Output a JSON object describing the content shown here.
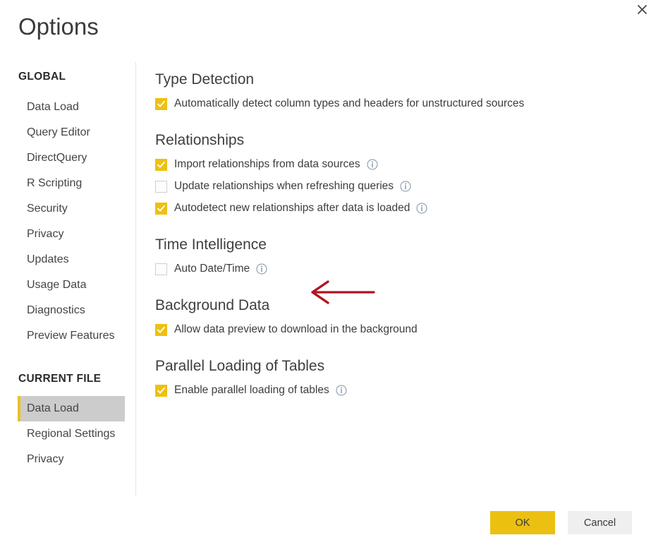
{
  "window": {
    "title": "Options",
    "close_icon": "close-icon"
  },
  "sidebar": {
    "groups": [
      {
        "title": "GLOBAL",
        "items": [
          {
            "label": "Data Load",
            "selected": false
          },
          {
            "label": "Query Editor",
            "selected": false
          },
          {
            "label": "DirectQuery",
            "selected": false
          },
          {
            "label": "R Scripting",
            "selected": false
          },
          {
            "label": "Security",
            "selected": false
          },
          {
            "label": "Privacy",
            "selected": false
          },
          {
            "label": "Updates",
            "selected": false
          },
          {
            "label": "Usage Data",
            "selected": false
          },
          {
            "label": "Diagnostics",
            "selected": false
          },
          {
            "label": "Preview Features",
            "selected": false
          }
        ]
      },
      {
        "title": "CURRENT FILE",
        "items": [
          {
            "label": "Data Load",
            "selected": true
          },
          {
            "label": "Regional Settings",
            "selected": false
          },
          {
            "label": "Privacy",
            "selected": false
          }
        ]
      }
    ]
  },
  "main": {
    "sections": [
      {
        "heading": "Type Detection",
        "options": [
          {
            "label": "Automatically detect column types and headers for unstructured sources",
            "checked": true,
            "info": false
          }
        ]
      },
      {
        "heading": "Relationships",
        "options": [
          {
            "label": "Import relationships from data sources",
            "checked": true,
            "info": true
          },
          {
            "label": "Update relationships when refreshing queries",
            "checked": false,
            "info": true
          },
          {
            "label": "Autodetect new relationships after data is loaded",
            "checked": true,
            "info": true
          }
        ]
      },
      {
        "heading": "Time Intelligence",
        "options": [
          {
            "label": "Auto Date/Time",
            "checked": false,
            "info": true
          }
        ]
      },
      {
        "heading": "Background Data",
        "options": [
          {
            "label": "Allow data preview to download in the background",
            "checked": true,
            "info": false
          }
        ]
      },
      {
        "heading": "Parallel Loading of Tables",
        "options": [
          {
            "label": "Enable parallel loading of tables",
            "checked": true,
            "info": true
          }
        ]
      }
    ]
  },
  "annotation": {
    "type": "arrow",
    "direction": "left",
    "points_at": "Auto Date/Time",
    "color": "#b01520"
  },
  "footer": {
    "ok_label": "OK",
    "cancel_label": "Cancel"
  },
  "colors": {
    "accent": "#eec010",
    "selected_nav_bg": "#cccccc",
    "info_icon": "#6b7f95",
    "annotation_red": "#b01520"
  }
}
